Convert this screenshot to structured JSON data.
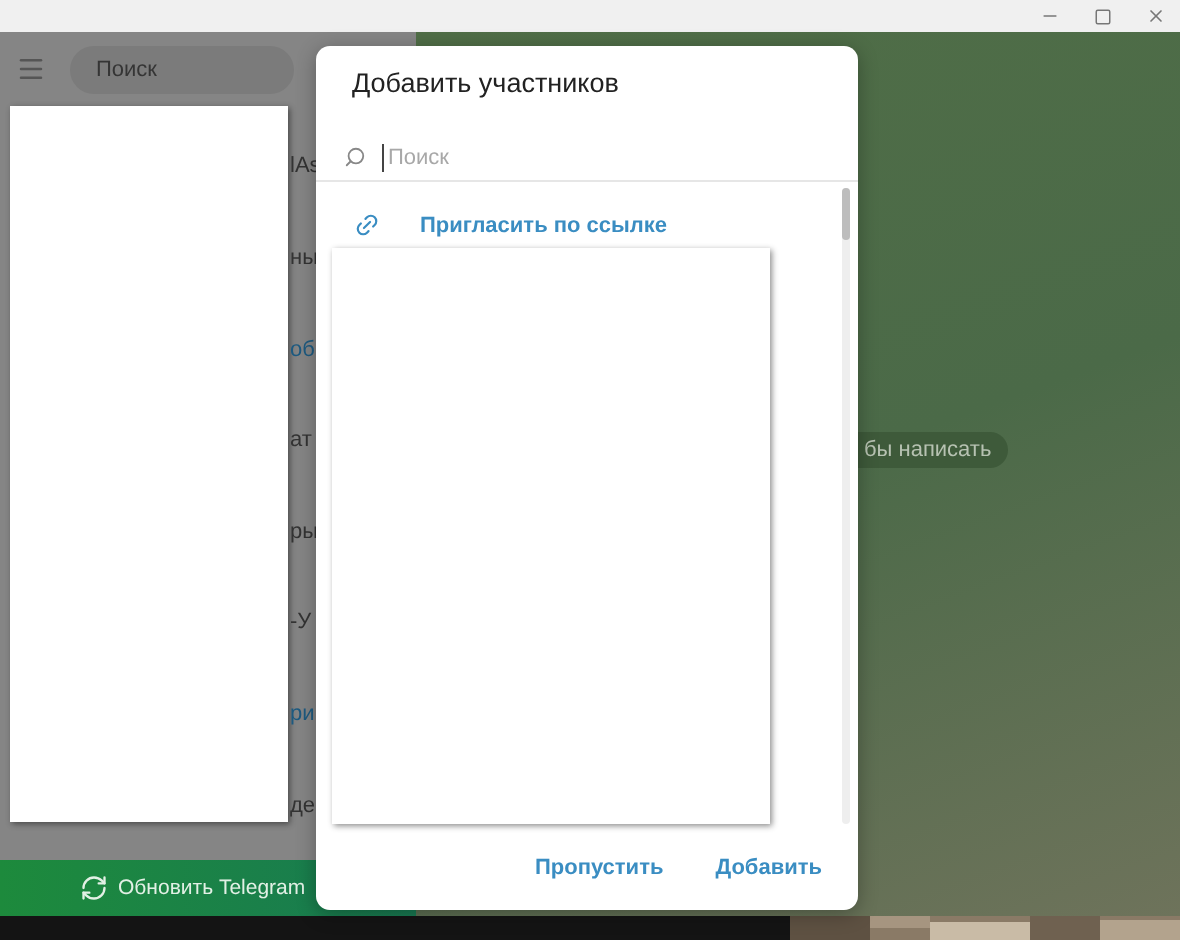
{
  "sidebar": {
    "search": {
      "placeholder": "Поиск"
    },
    "chat_fragments": [
      {
        "text": "lAs",
        "kind": "plain"
      },
      {
        "text": "ны",
        "kind": "plain"
      },
      {
        "text": "об",
        "kind": "link"
      },
      {
        "text": "ат",
        "kind": "plain"
      },
      {
        "text": "ры",
        "kind": "plain"
      },
      {
        "text": "-У",
        "kind": "plain"
      },
      {
        "text": "ри",
        "kind": "link"
      },
      {
        "text": "де",
        "kind": "plain"
      }
    ],
    "update_bar": {
      "label": "Обновить Telegram"
    }
  },
  "chat": {
    "hint": "бы написать"
  },
  "dialog": {
    "title": "Добавить участников",
    "search": {
      "placeholder": "Поиск"
    },
    "invite_link": "Пригласить по ссылке",
    "buttons": [
      "Пропустить",
      "Добавить"
    ]
  }
}
